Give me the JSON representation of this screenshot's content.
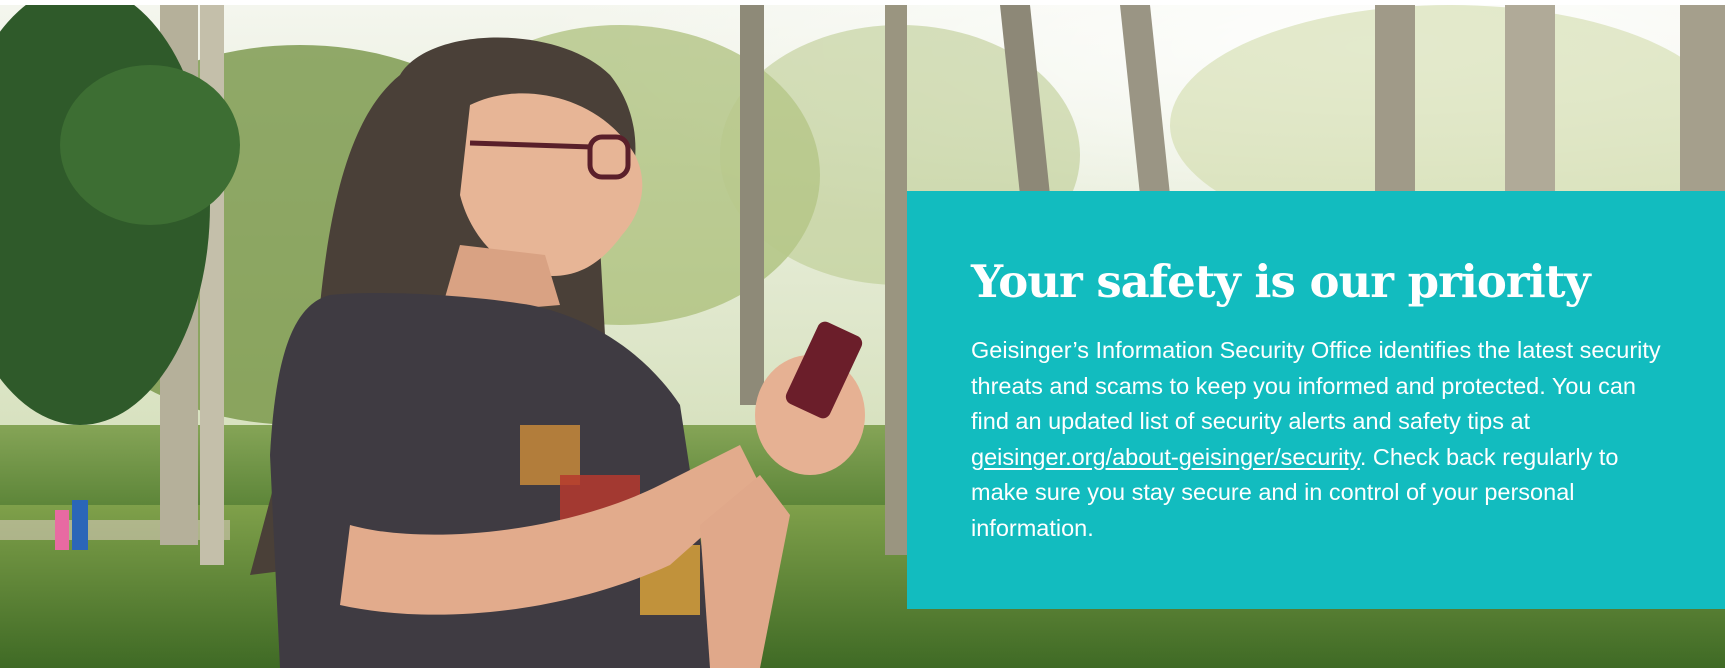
{
  "banner": {
    "image_description_icon": "photo-woman-using-phone-in-park",
    "accent_color": "#12bcbf",
    "title": "Your safety is our priority",
    "body_before_link": "Geisinger’s Information Security Office identifies the latest security threats and scams to keep you informed and protected. You can find an updated list of security alerts and safety tips at ",
    "link_text": "geisinger.org/about-geisinger/security",
    "body_after_link": ". Check back regularly to make sure you stay secure and in control of your personal information."
  }
}
